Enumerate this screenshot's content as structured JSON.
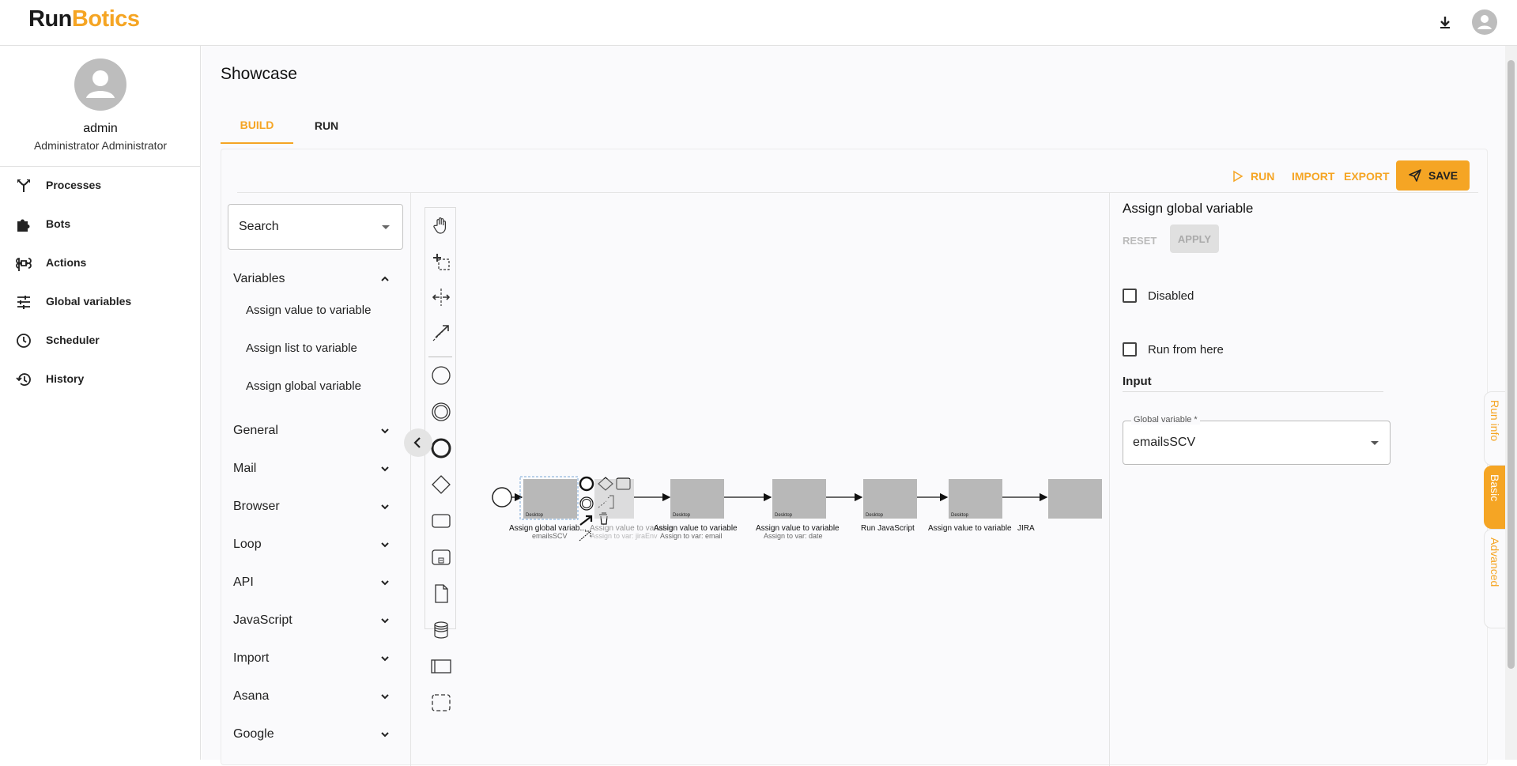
{
  "header": {
    "logo_run": "Run",
    "logo_botics": "Botics"
  },
  "user": {
    "name": "admin",
    "role": "Administrator Administrator"
  },
  "sidebar": {
    "items": [
      {
        "label": "Processes",
        "icon": "processes-icon"
      },
      {
        "label": "Bots",
        "icon": "puzzle-icon"
      },
      {
        "label": "Actions",
        "icon": "command-icon"
      },
      {
        "label": "Global variables",
        "icon": "sliders-icon"
      },
      {
        "label": "Scheduler",
        "icon": "clock-icon"
      },
      {
        "label": "History",
        "icon": "history-icon"
      }
    ]
  },
  "page": {
    "title": "Showcase",
    "tabs": [
      "BUILD",
      "RUN"
    ]
  },
  "toolbar": {
    "run_label": "RUN",
    "import_label": "IMPORT",
    "export_label": "EXPORT",
    "save_label": "SAVE"
  },
  "palette": {
    "search_text": "Search",
    "categories": [
      "Variables",
      "General",
      "Mail",
      "Browser",
      "Loop",
      "API",
      "JavaScript",
      "Import",
      "Asana",
      "Google"
    ],
    "variables_items": [
      "Assign value to variable",
      "Assign list to variable",
      "Assign global variable"
    ]
  },
  "diagram": {
    "nodes": [
      {
        "label": "Assign global variab...",
        "sub": "emailsSCV",
        "badge": "Desktop"
      },
      {
        "label": "Assign value to variable",
        "sub": "Assign to var: jiraEnv",
        "badge": "Desktop"
      },
      {
        "label": "Assign value to variable",
        "sub": "Assign to var: email",
        "badge": "Desktop"
      },
      {
        "label": "Assign value to variable",
        "sub": "Assign to var: date",
        "badge": "Desktop"
      },
      {
        "label": "Run JavaScript",
        "sub": "",
        "badge": "Desktop"
      },
      {
        "label": "Assign value to variable",
        "sub": "",
        "badge": "Desktop"
      },
      {
        "label": "JIRA",
        "sub": "",
        "badge": ""
      }
    ]
  },
  "properties": {
    "title": "Assign global variable",
    "reset_label": "RESET",
    "apply_label": "APPLY",
    "disabled_label": "Disabled",
    "run_from_here_label": "Run from here",
    "input_heading": "Input",
    "global_variable_label": "Global variable *",
    "global_variable_value": "emailsSCV"
  },
  "side_tabs": [
    "Run info",
    "Basic",
    "Advanced"
  ],
  "colors": {
    "accent": "#f5a524",
    "node_fill": "#b8b8b8"
  }
}
